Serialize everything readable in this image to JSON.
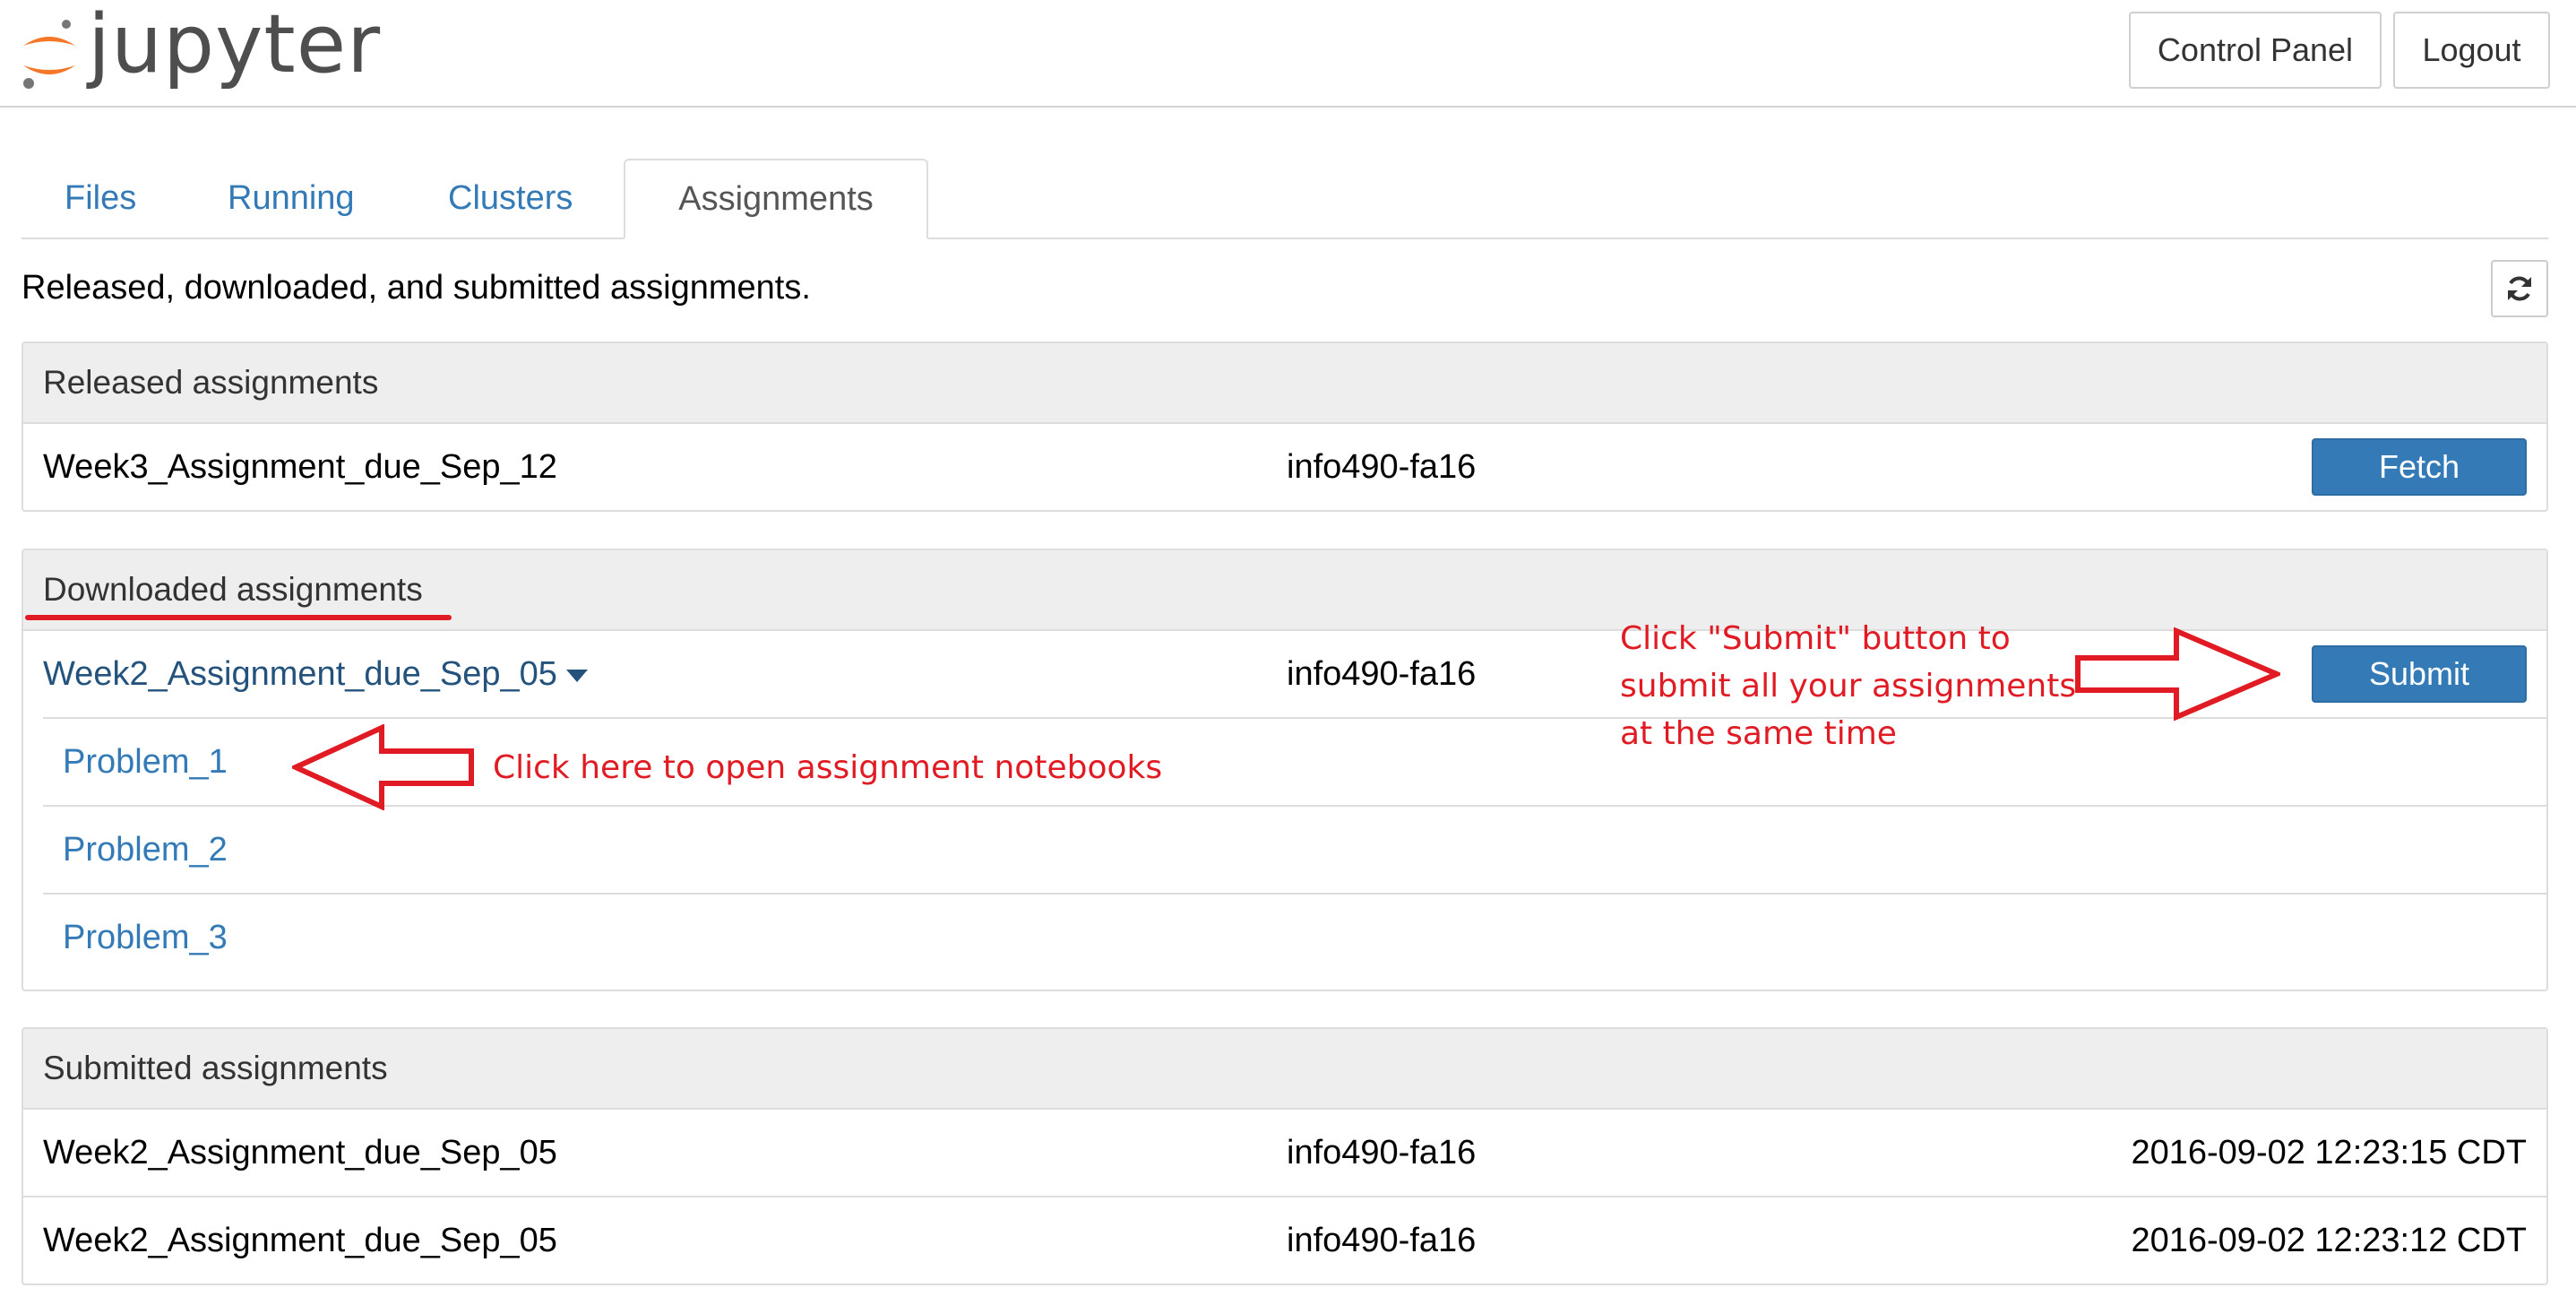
{
  "header": {
    "logo_text": "jupyter",
    "control_panel_label": "Control Panel",
    "logout_label": "Logout"
  },
  "tabs": [
    {
      "label": "Files"
    },
    {
      "label": "Running"
    },
    {
      "label": "Clusters"
    },
    {
      "label": "Assignments",
      "active": true
    }
  ],
  "description": "Released, downloaded, and submitted assignments.",
  "released": {
    "heading": "Released assignments",
    "rows": [
      {
        "name": "Week3_Assignment_due_Sep_12",
        "course": "info490-fa16",
        "action": "Fetch"
      }
    ]
  },
  "downloaded": {
    "heading": "Downloaded assignments",
    "rows": [
      {
        "name": "Week2_Assignment_due_Sep_05",
        "course": "info490-fa16",
        "action": "Submit",
        "notebooks": [
          "Problem_1",
          "Problem_2",
          "Problem_3"
        ]
      }
    ]
  },
  "submitted": {
    "heading": "Submitted assignments",
    "rows": [
      {
        "name": "Week2_Assignment_due_Sep_05",
        "course": "info490-fa16",
        "timestamp": "2016-09-02 12:23:15 CDT"
      },
      {
        "name": "Week2_Assignment_due_Sep_05",
        "course": "info490-fa16",
        "timestamp": "2016-09-02 12:23:12 CDT"
      }
    ]
  },
  "annotations": {
    "submit_note": [
      "Click \"Submit\" button to",
      "submit all your assignments",
      "at the same time"
    ],
    "notebook_note": "Click here to open assignment notebooks"
  },
  "colors": {
    "primary": "#337ab7",
    "annotation": "#e01b24",
    "logo_orange": "#f37726"
  }
}
